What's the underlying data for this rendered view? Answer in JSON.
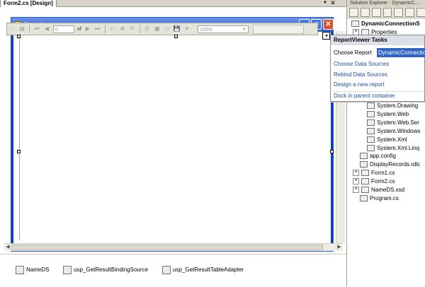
{
  "document_tab": {
    "title": "Form2.cs [Design]"
  },
  "form": {
    "title": "Form2"
  },
  "report_viewer_toolbar": {
    "page_value": "0",
    "of_label": "of",
    "zoom_value": "100%"
  },
  "component_tray": {
    "items": [
      {
        "label": "NameDS"
      },
      {
        "label": "usp_GetResultBindingSource"
      },
      {
        "label": "usp_GetResultTableAdapter"
      }
    ]
  },
  "tasks_panel": {
    "header": "ReportViewer Tasks",
    "choose_report_label": "Choose Report",
    "choose_report_value": "DynamicConnection",
    "links": [
      "Choose Data Sources",
      "Rebind Data Sources",
      "Design a new report"
    ],
    "dock_link": "Dock in parent container"
  },
  "solution_explorer": {
    "title": "Solution Explorer - DynamicC...",
    "project": "DynamicConnectionS",
    "properties": "Properties",
    "references": [
      "System.Drawing",
      "System.Web",
      "System.Web.Ser",
      "System.Windows",
      "System.Xml",
      "System.Xml.Linq"
    ],
    "files": [
      {
        "label": "app.config",
        "expandable": false
      },
      {
        "label": "DisplayRecords.rdlc",
        "expandable": false
      },
      {
        "label": "Form1.cs",
        "expandable": true
      },
      {
        "label": "Form2.cs",
        "expandable": true
      },
      {
        "label": "NameDS.xsd",
        "expandable": true
      },
      {
        "label": "Program.cs",
        "expandable": false
      }
    ]
  }
}
